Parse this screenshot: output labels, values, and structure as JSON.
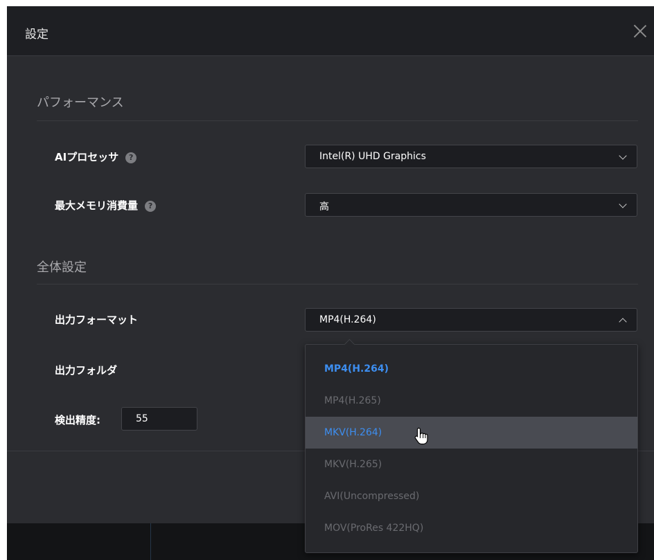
{
  "dialog": {
    "title": "設定",
    "close_icon": "close-icon"
  },
  "performance": {
    "section_title": "パフォーマンス",
    "ai_processor": {
      "label": "AIプロセッサ",
      "help_icon": "help-icon",
      "help_glyph": "?",
      "value": "Intel(R) UHD Graphics"
    },
    "max_memory": {
      "label": "最大メモリ消費量",
      "help_icon": "help-icon",
      "help_glyph": "?",
      "value": "高"
    }
  },
  "general": {
    "section_title": "全体設定",
    "output_format": {
      "label": "出力フォーマット",
      "value": "MP4(H.264)",
      "expanded": true,
      "options": [
        {
          "label": "MP4(H.264)",
          "state": "selected"
        },
        {
          "label": "MP4(H.265)",
          "state": "disabled"
        },
        {
          "label": "MKV(H.264)",
          "state": "hover"
        },
        {
          "label": "MKV(H.265)",
          "state": "disabled"
        },
        {
          "label": "AVI(Uncompressed)",
          "state": "disabled"
        },
        {
          "label": "MOV(ProRes 422HQ)",
          "state": "disabled"
        }
      ]
    },
    "output_folder": {
      "label": "出力フォルダ"
    },
    "detection_accuracy": {
      "label": "検出精度:",
      "value": "55"
    }
  },
  "colors": {
    "accent": "#3d8ef0",
    "dialog_bg": "#2b2c30",
    "titlebar_bg": "#1e1f23",
    "input_bg": "#1c1d21",
    "hover_bg": "#494b52",
    "disabled_text": "#6a6b70"
  },
  "cursor_icon": "hand-pointer-icon"
}
